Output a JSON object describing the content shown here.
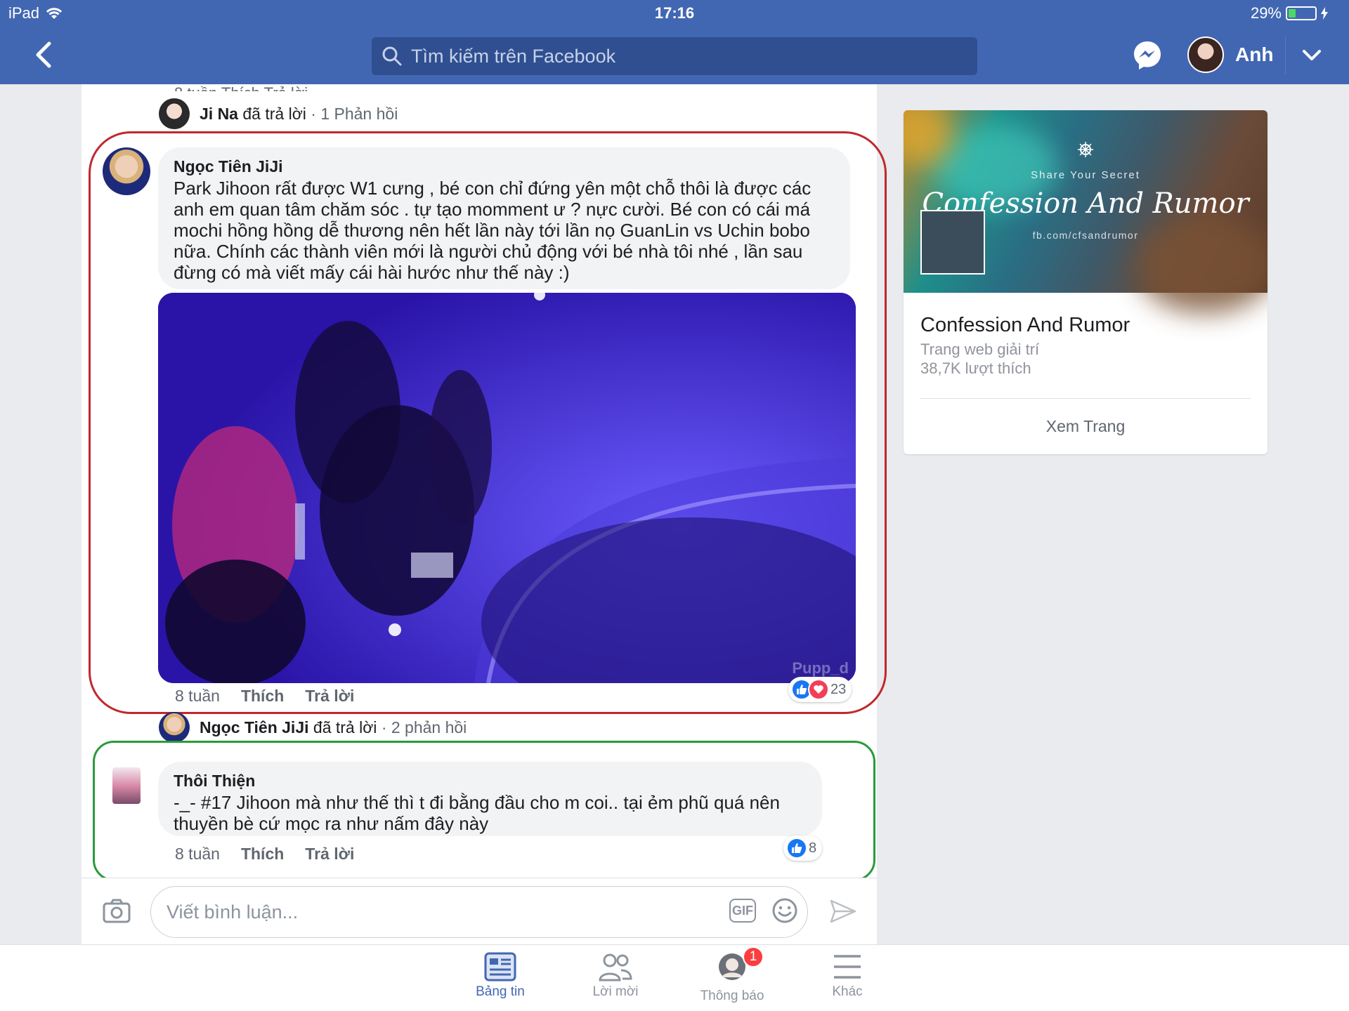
{
  "status_bar": {
    "device": "iPad",
    "time": "17:16",
    "battery": "29%",
    "battery_level": 0.29
  },
  "nav": {
    "search_placeholder": "Tìm kiếm trên Facebook",
    "user_name": "Anh"
  },
  "thread": {
    "top_partial": "8 tuần    Thích    Trả lời",
    "reply_summary_1": {
      "author": "Ji Na",
      "verb": "đã trả lời",
      "count": "· 1 Phản hồi"
    },
    "comment_1": {
      "author": "Ngọc Tiên JiJi",
      "text": "Park Jihoon rất được W1 cưng , bé con chỉ đứng yên một chỗ thôi là được các anh em quan tâm chăm sóc . tự tạo momment ư ? nực cười. Bé con có cái má mochi hồng hồng dễ thương nên hết lần này tới lần nọ GuanLin vs Uchin bobo nữa. Chính các thành viên mới là người chủ động với bé nhà tôi nhé , lần sau đừng có mà viết mấy cái hài hước như thế này :)",
      "media_watermark": "Pupp_d",
      "time": "8 tuần",
      "like": "Thích",
      "reply": "Trả lời",
      "reactions_count": "23"
    },
    "reply_summary_2": {
      "author": "Ngọc Tiên JiJi",
      "verb": "đã trả lời",
      "count": "· 2 phản hồi"
    },
    "comment_2": {
      "author": "Thôi Thiện",
      "text": "-_- #17 Jihoon mà như thế thì t đi bằng đầu cho m coi.. tại ẻm phũ quá nên thuyền bè cứ mọc ra như nấm đây này",
      "time": "8 tuần",
      "like": "Thích",
      "reply": "Trả lời",
      "reactions_count": "8"
    }
  },
  "composer": {
    "placeholder": "Viết bình luận...",
    "gif_label": "GIF"
  },
  "page_card": {
    "cover_tagline": "Share Your Secret",
    "cover_title": "Confession And Rumor",
    "cover_url": "fb.com/cfsandrumor",
    "name": "Confession And Rumor",
    "category": "Trang web giải trí",
    "likes": "38,7K lượt thích",
    "view_button": "Xem Trang"
  },
  "tabs": [
    {
      "label": "Bảng tin",
      "icon": "news-feed-icon",
      "active": true
    },
    {
      "label": "Lời mời",
      "icon": "friend-requests-icon",
      "active": false
    },
    {
      "label": "Thông báo",
      "icon": "notifications-icon",
      "active": false,
      "badge": "1"
    },
    {
      "label": "Khác",
      "icon": "menu-icon",
      "active": false
    }
  ],
  "colors": {
    "brand": "#4267b2",
    "highlight_red": "#c0282e",
    "highlight_green": "#2a9a3a",
    "badge": "#fa3e3e"
  }
}
